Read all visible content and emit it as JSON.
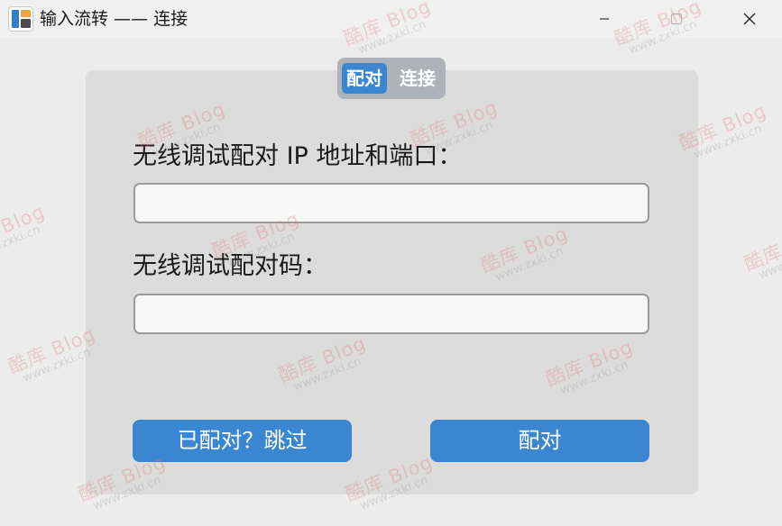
{
  "window": {
    "title": "输入流转 —— 连接",
    "icons": {
      "app": "app-icon",
      "minimize": "minimize-icon",
      "maximize": "maximize-icon",
      "close": "close-icon"
    }
  },
  "tabs": [
    {
      "label": "配对",
      "selected": true
    },
    {
      "label": "连接",
      "selected": false
    }
  ],
  "form": {
    "ip_label": "无线调试配对 IP 地址和端口：",
    "ip_value": "",
    "code_label": "无线调试配对码：",
    "code_value": ""
  },
  "actions": {
    "skip_label": "已配对？跳过",
    "pair_label": "配对"
  },
  "watermark": {
    "brand": "酷库",
    "blog": "Blog",
    "url": "www.zxki.cn"
  },
  "colors": {
    "accent": "#3a86d0",
    "panel": "#dcdcdc",
    "background": "#ececec",
    "tab_track": "#adb3b9"
  }
}
